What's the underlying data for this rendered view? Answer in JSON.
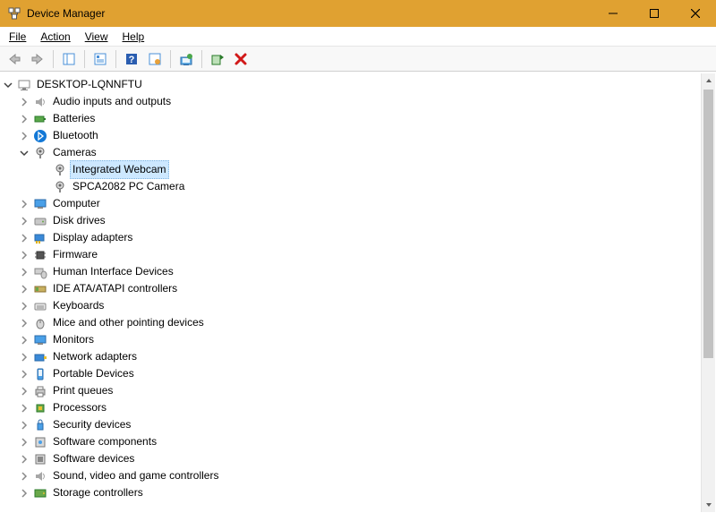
{
  "window": {
    "title": "Device Manager"
  },
  "menubar": {
    "file": "File",
    "action": "Action",
    "view": "View",
    "help": "Help"
  },
  "tree": {
    "root": {
      "label": "DESKTOP-LQNNFTU"
    },
    "audio": {
      "label": "Audio inputs and outputs"
    },
    "batteries": {
      "label": "Batteries"
    },
    "bluetooth": {
      "label": "Bluetooth"
    },
    "cameras": {
      "label": "Cameras"
    },
    "camera_integrated": {
      "label": "Integrated Webcam"
    },
    "camera_spca": {
      "label": "SPCA2082 PC Camera"
    },
    "computer": {
      "label": "Computer"
    },
    "diskdrives": {
      "label": "Disk drives"
    },
    "display": {
      "label": "Display adapters"
    },
    "firmware": {
      "label": "Firmware"
    },
    "hid": {
      "label": "Human Interface Devices"
    },
    "ide": {
      "label": "IDE ATA/ATAPI controllers"
    },
    "keyboards": {
      "label": "Keyboards"
    },
    "mice": {
      "label": "Mice and other pointing devices"
    },
    "monitors": {
      "label": "Monitors"
    },
    "network": {
      "label": "Network adapters"
    },
    "portable": {
      "label": "Portable Devices"
    },
    "printqueues": {
      "label": "Print queues"
    },
    "processors": {
      "label": "Processors"
    },
    "security": {
      "label": "Security devices"
    },
    "softcomp": {
      "label": "Software components"
    },
    "softdev": {
      "label": "Software devices"
    },
    "sound": {
      "label": "Sound, video and game controllers"
    },
    "storage": {
      "label": "Storage controllers"
    }
  }
}
